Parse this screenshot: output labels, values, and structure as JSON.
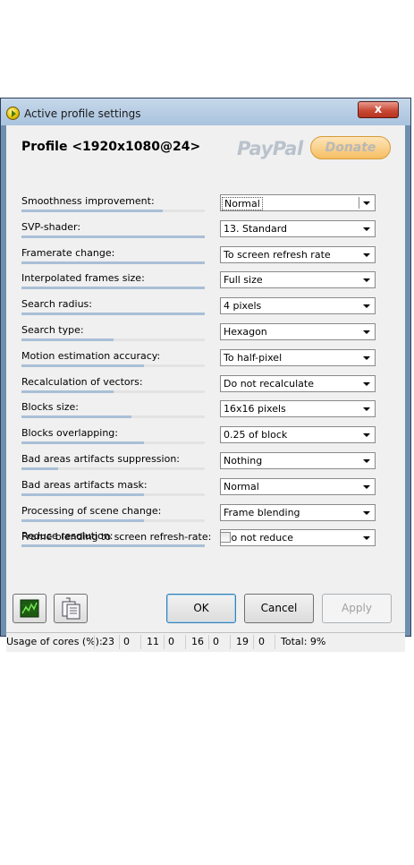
{
  "window": {
    "title": "Active profile settings",
    "close_label": "x"
  },
  "profile": {
    "title": "Profile <1920x1080@24>"
  },
  "paypal": {
    "brand": "PayPal",
    "donate_label": "Donate"
  },
  "settings": [
    {
      "label": "Smoothness improvement:",
      "value": "Normal",
      "level": 0.77
    },
    {
      "label": "SVP-shader:",
      "value": "13. Standard",
      "level": 1.0
    },
    {
      "label": "Framerate change:",
      "value": "To screen refresh rate",
      "level": 1.0
    },
    {
      "label": "Interpolated frames size:",
      "value": "Full size",
      "level": 1.0
    },
    {
      "label": "Search radius:",
      "value": "4 pixels",
      "level": 1.0
    },
    {
      "label": "Search type:",
      "value": "Hexagon",
      "level": 0.5
    },
    {
      "label": "Motion estimation accuracy:",
      "value": "To half-pixel",
      "level": 0.67
    },
    {
      "label": "Recalculation of vectors:",
      "value": "Do not recalculate",
      "level": 0.5
    },
    {
      "label": "Blocks size:",
      "value": "16x16 pixels",
      "level": 0.6
    },
    {
      "label": "Blocks overlapping:",
      "value": "0.25 of block",
      "level": 0.67
    },
    {
      "label": "Bad areas artifacts suppression:",
      "value": "Nothing",
      "level": 0.2
    },
    {
      "label": "Bad areas artifacts mask:",
      "value": "Normal",
      "level": 0.67
    },
    {
      "label": "Processing of scene change:",
      "value": "Frame blending",
      "level": 0.67
    },
    {
      "label": "Reduce resolution:",
      "value": "Do not reduce",
      "level": 1.0
    }
  ],
  "blending": {
    "label": "Frame blending to screen refresh-rate:",
    "checked": false
  },
  "buttons": {
    "ok": "OK",
    "cancel": "Cancel",
    "apply": "Apply"
  },
  "icons": {
    "graph": "graph-icon",
    "copy": "copy-icon"
  },
  "status": {
    "label": "Usage of cores (%):",
    "cores": [
      "23",
      "0",
      "11",
      "0",
      "16",
      "0",
      "19",
      "0"
    ],
    "total": "Total: 9%"
  }
}
